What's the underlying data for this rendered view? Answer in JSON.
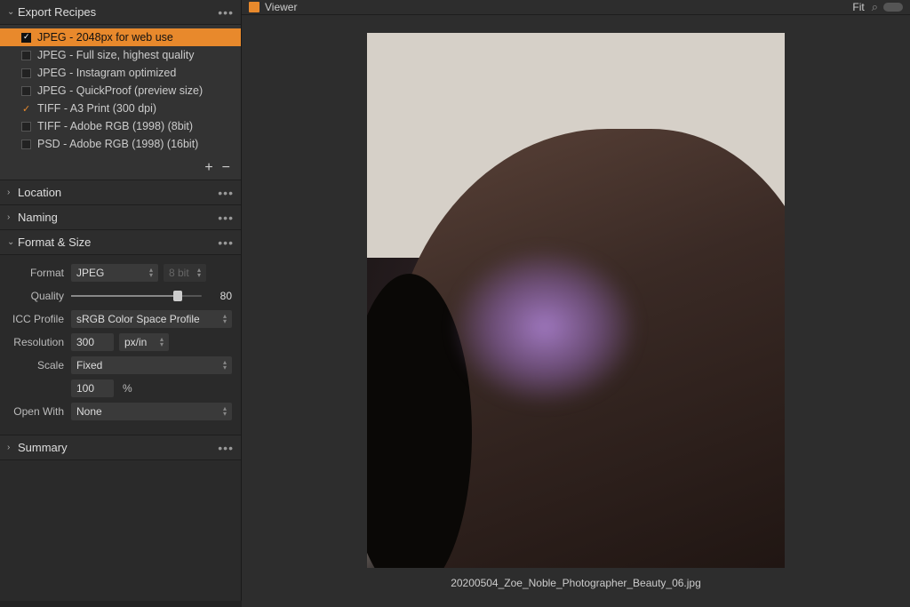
{
  "sidebar": {
    "panels": {
      "export_recipes": {
        "title": "Export Recipes",
        "expanded": true
      },
      "location": {
        "title": "Location",
        "expanded": false
      },
      "naming": {
        "title": "Naming",
        "expanded": false
      },
      "format_size": {
        "title": "Format & Size",
        "expanded": true
      },
      "summary": {
        "title": "Summary",
        "expanded": false
      }
    },
    "recipes": [
      {
        "label": "JPEG - 2048px for web use",
        "selected": true,
        "checked": true
      },
      {
        "label": "JPEG - Full size, highest quality",
        "selected": false,
        "checked": false
      },
      {
        "label": "JPEG - Instagram optimized",
        "selected": false,
        "checked": false
      },
      {
        "label": "JPEG - QuickProof (preview size)",
        "selected": false,
        "checked": false
      },
      {
        "label": "TIFF - A3 Print (300 dpi)",
        "selected": false,
        "checked": true
      },
      {
        "label": "TIFF - Adobe RGB (1998)  (8bit)",
        "selected": false,
        "checked": false
      },
      {
        "label": "PSD - Adobe RGB (1998)  (16bit)",
        "selected": false,
        "checked": false
      }
    ],
    "format": {
      "format_label": "Format",
      "format_value": "JPEG",
      "bit_depth": "8 bit",
      "quality_label": "Quality",
      "quality_value": "80",
      "icc_label": "ICC Profile",
      "icc_value": "sRGB Color Space Profile",
      "resolution_label": "Resolution",
      "resolution_value": "300",
      "resolution_unit": "px/in",
      "scale_label": "Scale",
      "scale_value": "Fixed",
      "scale_pct": "100",
      "scale_pct_unit": "%",
      "openwith_label": "Open With",
      "openwith_value": "None"
    }
  },
  "viewer": {
    "title": "Viewer",
    "fit_label": "Fit",
    "filename": "20200504_Zoe_Noble_Photographer_Beauty_06.jpg"
  }
}
